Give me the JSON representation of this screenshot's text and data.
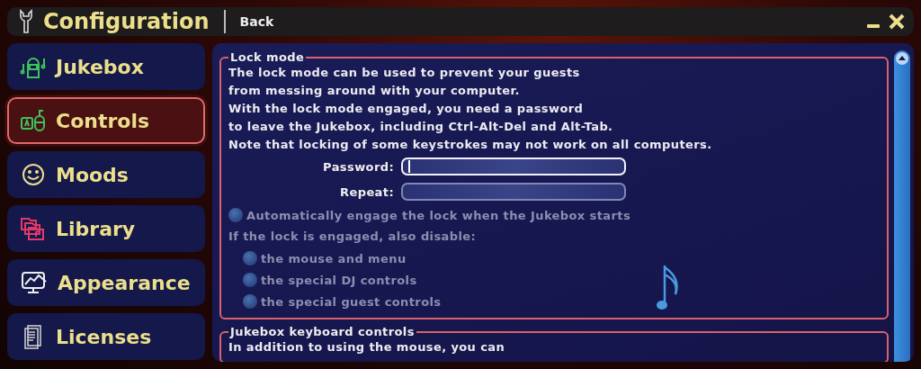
{
  "window": {
    "title": "Configuration",
    "back": "Back"
  },
  "sidebar": {
    "items": [
      {
        "label": "Jukebox",
        "selected": false
      },
      {
        "label": "Controls",
        "selected": true
      },
      {
        "label": "Moods",
        "selected": false
      },
      {
        "label": "Library",
        "selected": false
      },
      {
        "label": "Appearance",
        "selected": false
      },
      {
        "label": "Licenses",
        "selected": false
      }
    ]
  },
  "sections": [
    {
      "title": "Lock mode",
      "lines": [
        "The lock mode can be used to prevent your guests",
        "from messing around with your computer.",
        "With the lock mode engaged, you need a password",
        "to leave the Jukebox, including Ctrl-Alt-Del and Alt-Tab.",
        "Note that locking of some keystrokes may not work on all computers."
      ],
      "fields": [
        {
          "label": "Password:",
          "focused": true
        },
        {
          "label": "Repeat:",
          "focused": false
        }
      ],
      "auto_lock": {
        "label": "Automatically engage the lock when the Jukebox starts",
        "checked": false,
        "disabled": true
      },
      "disable_heading": "If the lock is engaged, also disable:",
      "options": [
        {
          "label": "the mouse and menu",
          "checked": false,
          "disabled": true
        },
        {
          "label": "the special DJ controls",
          "checked": false,
          "disabled": true
        },
        {
          "label": "the special guest controls",
          "checked": false,
          "disabled": true
        }
      ]
    },
    {
      "title": "Jukebox keyboard controls",
      "lines": [
        "In addition to using the mouse, you can"
      ]
    }
  ]
}
